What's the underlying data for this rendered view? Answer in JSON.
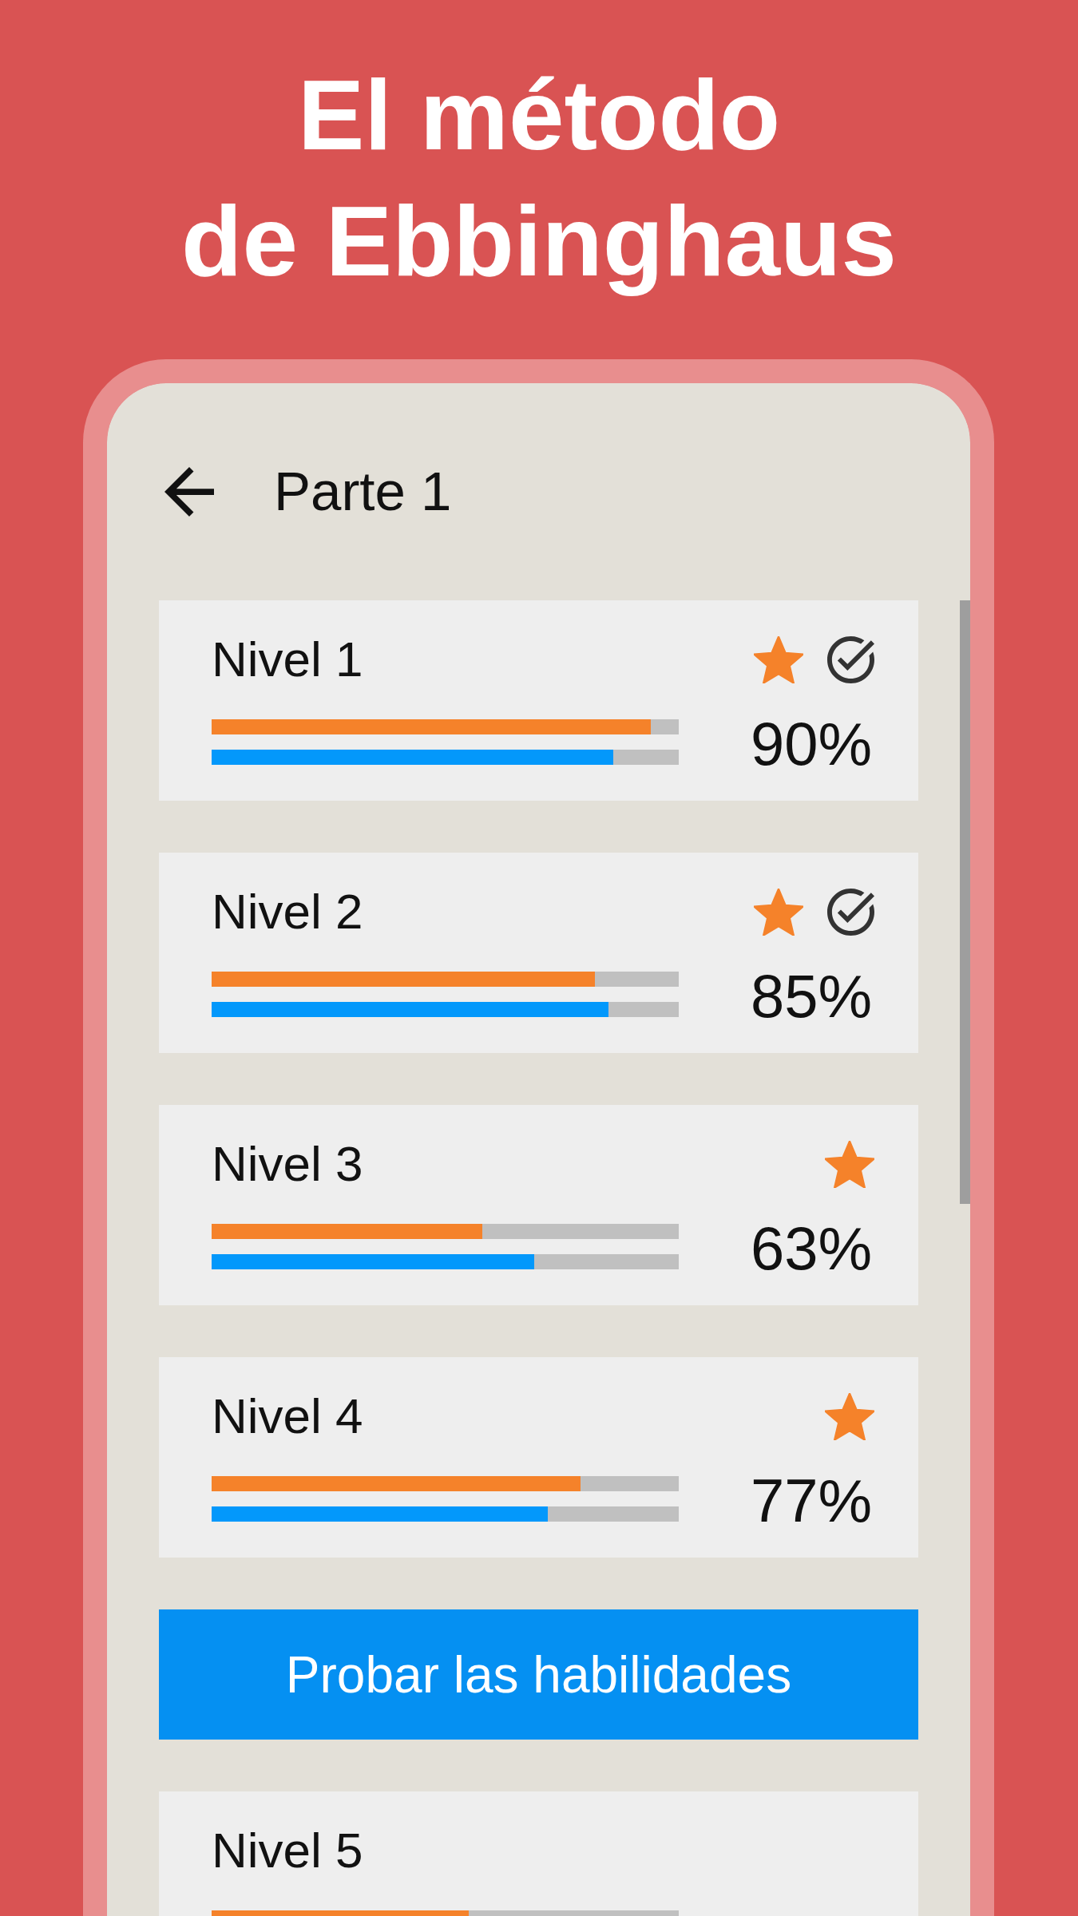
{
  "headline": [
    "El método",
    "de Ebbinghaus"
  ],
  "screen": {
    "title": "Parte 1",
    "items": [
      {
        "kind": "level",
        "title": "Nivel 1",
        "starred": true,
        "completed": true,
        "bars": [
          {
            "color": "#f5822a",
            "level": 0.94
          },
          {
            "color": "#0398fb",
            "level": 0.86
          }
        ],
        "percent": "90%"
      },
      {
        "kind": "level",
        "title": "Nivel 2",
        "starred": true,
        "completed": true,
        "bars": [
          {
            "color": "#f5822a",
            "level": 0.82
          },
          {
            "color": "#0398fb",
            "level": 0.85
          }
        ],
        "percent": "85%"
      },
      {
        "kind": "level",
        "title": "Nivel 3",
        "starred": true,
        "completed": false,
        "bars": [
          {
            "color": "#f5822a",
            "level": 0.58
          },
          {
            "color": "#0398fb",
            "level": 0.69
          }
        ],
        "percent": "63%"
      },
      {
        "kind": "level",
        "title": "Nivel 4",
        "starred": true,
        "completed": false,
        "bars": [
          {
            "color": "#f5822a",
            "level": 0.79
          },
          {
            "color": "#0398fb",
            "level": 0.72
          }
        ],
        "percent": "77%"
      },
      {
        "kind": "button",
        "label": "Probar las habilidades"
      },
      {
        "kind": "level",
        "title": "Nivel 5",
        "starred": false,
        "completed": false,
        "bars": [
          {
            "color": "#f5822a",
            "level": 0.55
          }
        ]
      }
    ]
  }
}
